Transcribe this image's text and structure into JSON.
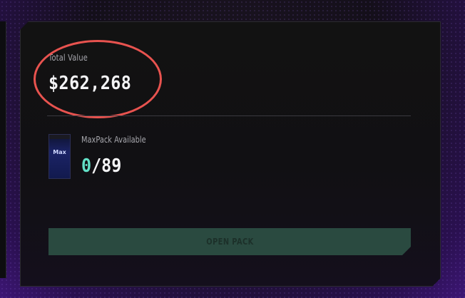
{
  "total": {
    "label": "Total Value",
    "value": "$262,268"
  },
  "pack": {
    "label": "MaxPack Available",
    "available": "0",
    "separator_total": "/89",
    "logo_text": "Max"
  },
  "actions": {
    "open_pack_label": "OPEN PACK"
  },
  "colors": {
    "accent_teal": "#62e0c6",
    "button_bg": "#2a4a40",
    "highlight": "#e8534f"
  },
  "icons": {
    "pack": "maxpack-image"
  }
}
